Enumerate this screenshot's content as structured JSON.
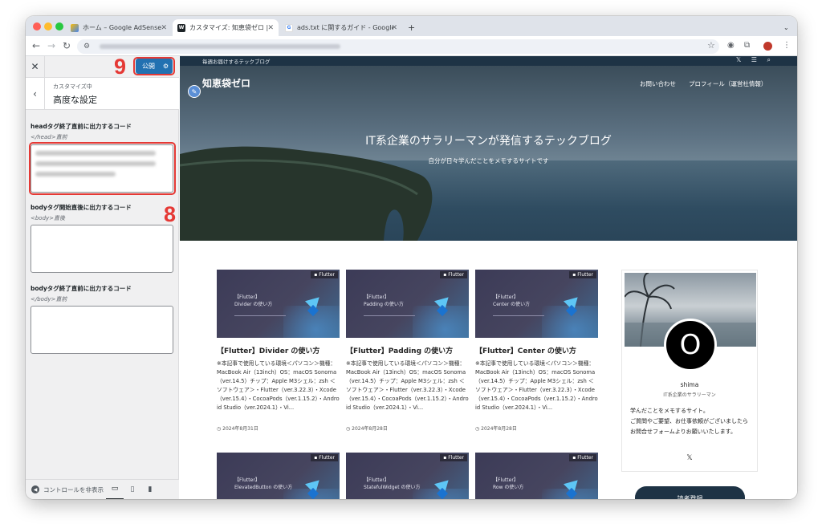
{
  "browser": {
    "tabs": [
      {
        "title": "ホーム – Google AdSense",
        "favicon": "adsense-icon"
      },
      {
        "title": "カスタマイズ: 知恵袋ゼロ | 毎週お届けする",
        "favicon": "wordpress-icon"
      },
      {
        "title": "ads.txt に関するガイド - Google",
        "favicon": "google-icon"
      }
    ],
    "new_tab": "+",
    "nav_back": "←",
    "nav_forward": "→",
    "nav_reload": "↻"
  },
  "customizer": {
    "close": "✕",
    "publish_label": "公開",
    "back": "‹",
    "section_sub": "カスタマイズ中",
    "section_title": "高度な設定",
    "fields": [
      {
        "label": "headタグ終了直前に出力するコード",
        "desc": "</head>直前",
        "value": ""
      },
      {
        "label": "bodyタグ開始直後に出力するコード",
        "desc": "<body>直後",
        "value": ""
      },
      {
        "label": "bodyタグ終了直前に出力するコード",
        "desc": "</body>直前",
        "value": ""
      }
    ],
    "hide_controls": "コントロールを非表示",
    "annotations": {
      "publish": "9",
      "head_field": "8"
    },
    "highlight_color": "#e53935"
  },
  "site": {
    "tagline": "毎週お届けするテックブログ",
    "title": "知恵袋ゼロ",
    "nav": [
      "お問い合わせ",
      "プロフィール（運営社情報）"
    ],
    "hero_heading": "IT系企業のサラリーマンが発信するテックブログ",
    "hero_sub": "自分が日々学んだことをメモするサイトです",
    "top_icons": "𝕏 ☰ ⌕",
    "posts": [
      {
        "category": "Flutter",
        "thumb_title": "【Flutter】\nDivider の使い方",
        "title": "【Flutter】Divider の使い方",
        "excerpt": "※本記事で使用している環境＜パソコン＞機種：MacBook Air（13inch）OS：macOS Sonoma（ver.14.5）チップ：Apple M3シェル：zsh ＜ソフトウェア＞・Flutter（ver.3.22.3）・Xcode（ver.15.4）・CocoaPods（ver.1.15.2）・Android Studio（ver.2024.1）・Vi...",
        "date": "2024年8月31日"
      },
      {
        "category": "Flutter",
        "thumb_title": "【Flutter】\nPadding の使い方",
        "title": "【Flutter】Padding の使い方",
        "excerpt": "※本記事で使用している環境＜パソコン＞機種：MacBook Air（13inch）OS：macOS Sonoma（ver.14.5）チップ：Apple M3シェル：zsh ＜ソフトウェア＞・Flutter（ver.3.22.3）・Xcode（ver.15.4）・CocoaPods（ver.1.15.2）・Android Studio（ver.2024.1）・Vi...",
        "date": "2024年8月28日"
      },
      {
        "category": "Flutter",
        "thumb_title": "【Flutter】\nCenter の使い方",
        "title": "【Flutter】Center の使い方",
        "excerpt": "※本記事で使用している環境＜パソコン＞機種：MacBook Air（13inch）OS：macOS Sonoma（ver.14.5）チップ：Apple M3シェル：zsh ＜ソフトウェア＞・Flutter（ver.3.22.3）・Xcode（ver.15.4）・CocoaPods（ver.1.15.2）・Android Studio（ver.2024.1）・Vi...",
        "date": "2024年8月28日"
      },
      {
        "category": "Flutter",
        "thumb_title": "【Flutter】\nElevatedButton の使い方"
      },
      {
        "category": "Flutter",
        "thumb_title": "【Flutter】\nStatefulWidget の使い方"
      },
      {
        "category": "Flutter",
        "thumb_title": "【Flutter】\nRow の使い方"
      }
    ],
    "profile": {
      "avatar_letter": "O",
      "name": "shima",
      "role": "IT系企業のサラリーマン",
      "bio": "学んだことをメモするサイト。\nご質問やご要望、お仕事依頼がございましたらお問合せフォームよりお願いいたします。",
      "social": "𝕏"
    },
    "more_button": "読者登録"
  }
}
